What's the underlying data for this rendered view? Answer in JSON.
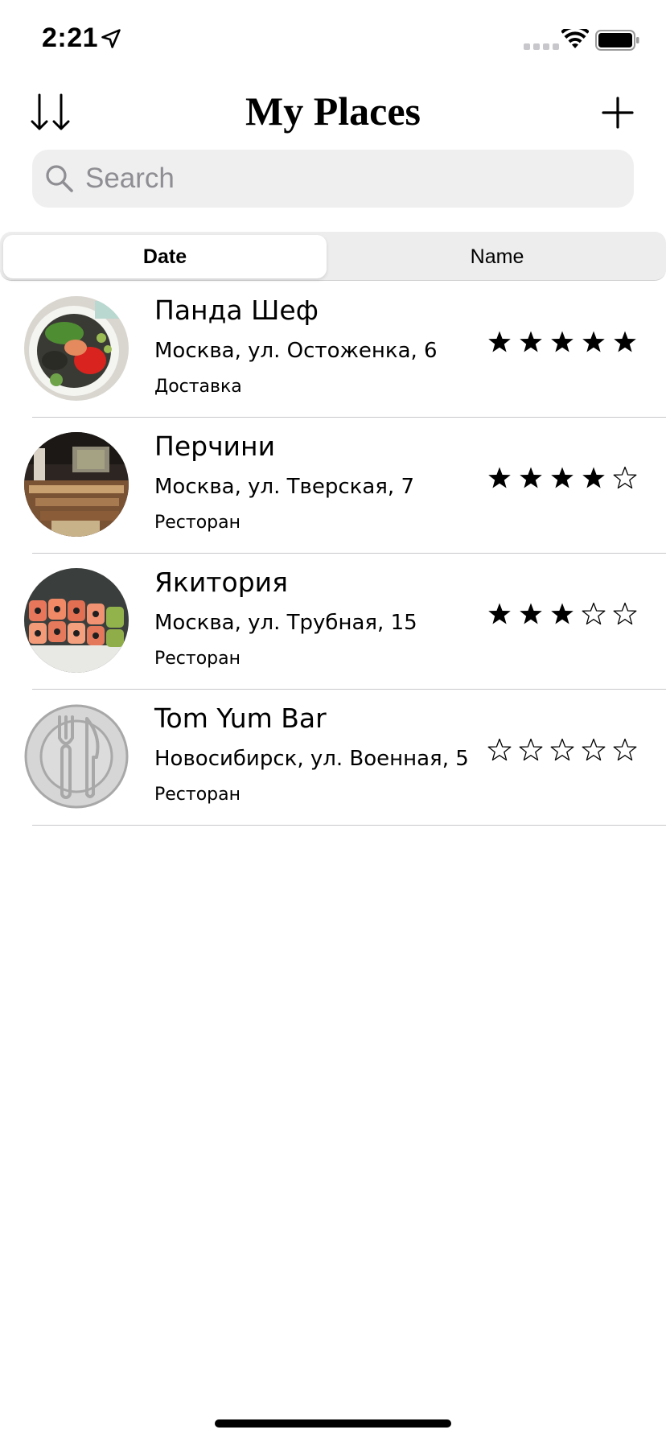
{
  "status_bar": {
    "time": "2:21",
    "icons": [
      "location-arrow-icon",
      "cellular-signal-icon",
      "wifi-icon",
      "battery-icon"
    ]
  },
  "nav": {
    "title": "My Places",
    "sort_icon": "sort-descending-icon",
    "add_icon": "plus-icon"
  },
  "search": {
    "placeholder": "Search",
    "value": ""
  },
  "segments": [
    {
      "label": "Date",
      "selected": true
    },
    {
      "label": "Name",
      "selected": false
    }
  ],
  "places": [
    {
      "name": "Панда Шеф",
      "address": "Москва, ул. Остоженка, 6",
      "type": "Доставка",
      "rating": 5,
      "image": "poke-bowl-photo"
    },
    {
      "name": "Перчини",
      "address": "Москва, ул. Тверская, 7",
      "type": "Ресторан",
      "rating": 4,
      "image": "restaurant-interior-photo"
    },
    {
      "name": "Якитория",
      "address": "Москва, ул. Трубная, 15",
      "type": "Ресторан",
      "rating": 3,
      "image": "sushi-rolls-photo"
    },
    {
      "name": "Tom Yum Bar",
      "address": "Новосибирск, ул. Военная, 5",
      "type": "Ресторан",
      "rating": 0,
      "image": "fork-knife-placeholder-icon"
    }
  ],
  "rating_max": 5,
  "colors": {
    "search_background": "#efeff0",
    "segment_background": "#ededee",
    "separator": "#c8c8cc",
    "placeholder_text": "#8e8e93"
  }
}
